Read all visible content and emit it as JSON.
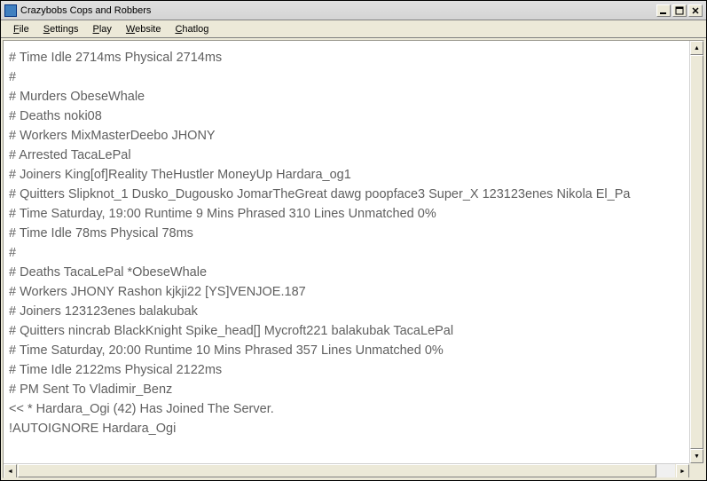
{
  "window": {
    "title": "Crazybobs Cops and Robbers"
  },
  "menu": {
    "file": "File",
    "settings": "Settings",
    "play": "Play",
    "website": "Website",
    "chatlog": "Chatlog"
  },
  "log": {
    "lines": [
      "# Time       Idle 2714ms Physical 2714ms",
      "#",
      "# Murders ObeseWhale",
      "# Deaths   noki08",
      "# Workers MixMasterDeebo JHONY",
      "# Arrested TacaLePal",
      "# Joiners   King[of]Reality TheHustler MoneyUp Hardara_og1",
      "# Quitters   Slipknot_1 Dusko_Dugousko JomarTheGreat dawg poopface3 Super_X 123123enes Nikola El_Pa",
      "# Time      Saturday, 19:00 Runtime 9 Mins Phrased 310 Lines Unmatched  0%",
      "# Time       Idle 78ms Physical 78ms",
      "#",
      "# Deaths   TacaLePal *ObeseWhale",
      "# Workers JHONY Rashon kjkji22 [YS]VENJOE.187",
      "# Joiners   123123enes balakubak",
      "# Quitters   nincrab BlackKnight Spike_head[] Mycroft221 balakubak TacaLePal",
      "# Time      Saturday, 20:00 Runtime 10 Mins Phrased 357 Lines Unmatched  0%",
      "# Time       Idle 2122ms Physical 2122ms",
      "# PM Sent To Vladimir_Benz",
      "<< * Hardara_Ogi (42) Has Joined The Server.",
      " !AUTOIGNORE Hardara_Ogi"
    ]
  }
}
